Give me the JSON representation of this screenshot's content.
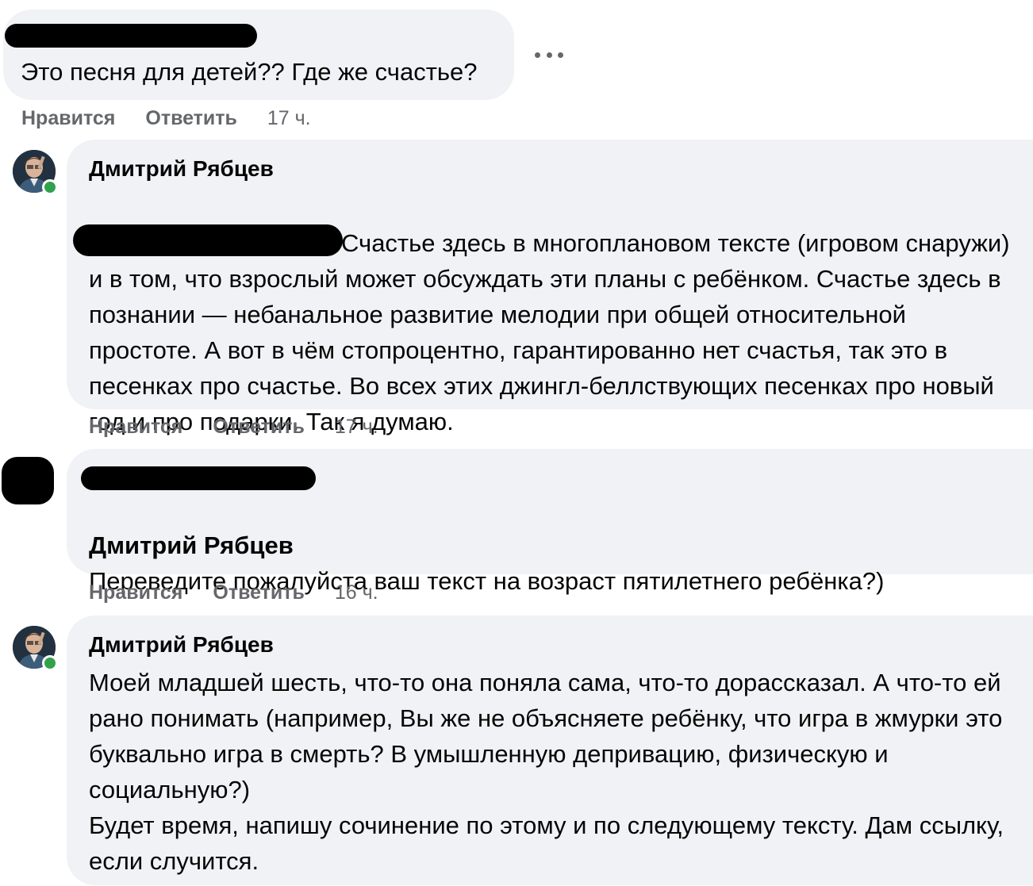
{
  "comments": [
    {
      "author": "",
      "text": "Это песня для детей?? Где же счастье?",
      "like_label": "Нравится",
      "reply_label": "Ответить",
      "time": "17 ч."
    },
    {
      "author": "Дмитрий Рябцев",
      "text": "Счастье здесь в многоплановом тексте (игровом снаружи) и в том, что взрослый может обсуждать эти планы с ребёнком. Счастье здесь в познании — небанальное развитие мелодии при общей относительной простоте. А вот в чём стопроцентно, гарантированно нет счастья, так это в песенках про счастье. Во всех этих джингл-беллствующих песенках про новый год и про подарки. Так я думаю.",
      "like_label": "Нравится",
      "reply_label": "Ответить",
      "time": "17 ч."
    },
    {
      "author": "",
      "mention": "Дмитрий Рябцев",
      "text": "Переведите пожалуйста ваш текст на возраст пятилетнего ребёнка?)",
      "like_label": "Нравится",
      "reply_label": "Ответить",
      "time": "16 ч."
    },
    {
      "author": "Дмитрий Рябцев",
      "text": "Моей младшей шесть, что-то она поняла сама, что-то дорассказал. А что-то ей рано понимать (например, Вы же не объясняете ребёнку, что игра в жмурки это буквально игра в смерть? В умышленную депривацию, физическую и социальную?)\nБудет время, напишу сочинение по этому и по следующему тексту. Дам ссылку, если случится."
    }
  ],
  "colors": {
    "bubble": "#f0f2f5",
    "meta_text": "#65676b",
    "online": "#31a24c"
  },
  "icons": {
    "more": "more-options-icon"
  }
}
